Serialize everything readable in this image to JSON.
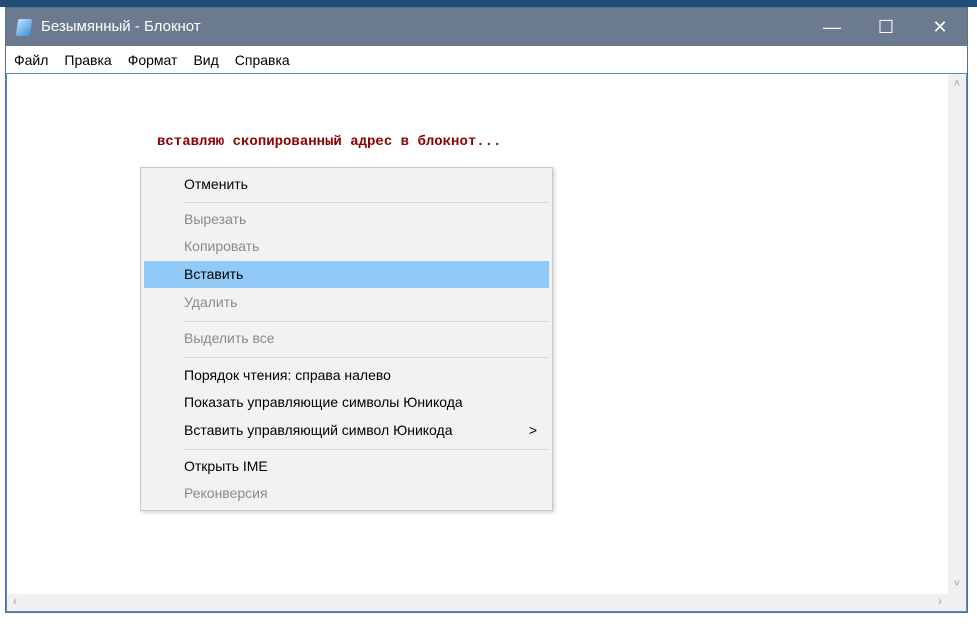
{
  "window": {
    "title": "Безымянный - Блокнот",
    "minimize": "—",
    "maximize": "☐",
    "close": "✕"
  },
  "menu": [
    "Файл",
    "Правка",
    "Формат",
    "Вид",
    "Справка"
  ],
  "caption": "вставляю скопированный адрес в блокнот...",
  "scroll": {
    "up": "˄",
    "down": "˅",
    "left": "‹",
    "right": "›"
  },
  "context_menu": {
    "items": [
      {
        "label": "Отменить",
        "enabled": true
      },
      {
        "label": "Вырезать",
        "enabled": false
      },
      {
        "label": "Копировать",
        "enabled": false
      },
      {
        "label": "Вставить",
        "enabled": true,
        "highlighted": true
      },
      {
        "label": "Удалить",
        "enabled": false
      },
      {
        "label": "Выделить все",
        "enabled": false
      },
      {
        "label": "Порядок чтения: справа налево",
        "enabled": true
      },
      {
        "label": "Показать управляющие символы Юникода",
        "enabled": true
      },
      {
        "label": "Вставить управляющий символ Юникода",
        "enabled": true,
        "submenu": ">"
      },
      {
        "label": "Открыть IME",
        "enabled": true
      },
      {
        "label": "Реконверсия",
        "enabled": false
      }
    ]
  }
}
